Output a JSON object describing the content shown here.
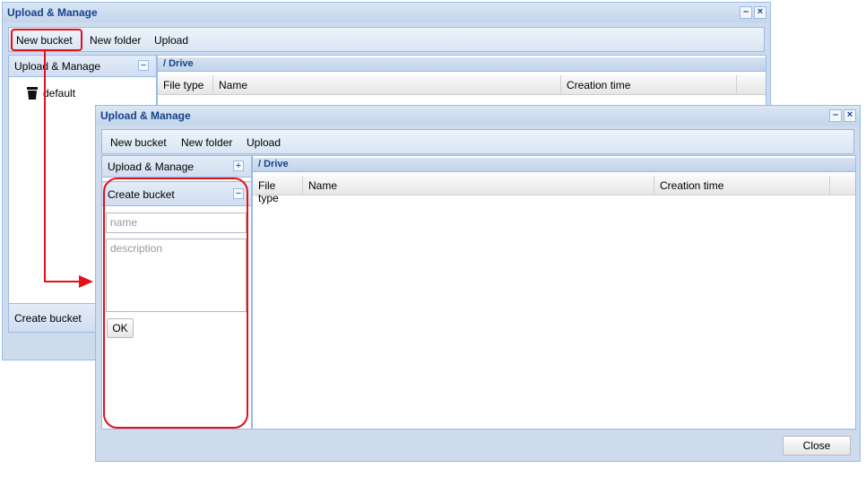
{
  "background_window": {
    "title": "Upload & Manage",
    "toolbar": {
      "new_bucket": "New bucket",
      "new_folder": "New folder",
      "upload": "Upload"
    },
    "left_panel": {
      "header": "Upload & Manage",
      "collapse_icon": "−",
      "tree_item": "default",
      "create_bucket": "Create bucket"
    },
    "breadcrumb": "/ Drive",
    "columns": {
      "file_type": "File type",
      "name": "Name",
      "creation_time": "Creation time"
    }
  },
  "foreground_window": {
    "title": "Upload & Manage",
    "toolbar": {
      "new_bucket": "New bucket",
      "new_folder": "New folder",
      "upload": "Upload"
    },
    "left_panel": {
      "upload_manage_header": "Upload & Manage",
      "expand_icon": "+",
      "create_bucket_header": "Create bucket",
      "collapse_icon": "−",
      "name_placeholder": "name",
      "description_placeholder": "description",
      "ok_label": "OK"
    },
    "breadcrumb": "/ Drive",
    "columns": {
      "file_type": "File type",
      "name": "Name",
      "creation_time": "Creation time"
    },
    "close_label": "Close"
  },
  "colors": {
    "annotation_red": "#e3111c",
    "title_blue": "#15428b",
    "border_blue": "#99bbe8"
  }
}
